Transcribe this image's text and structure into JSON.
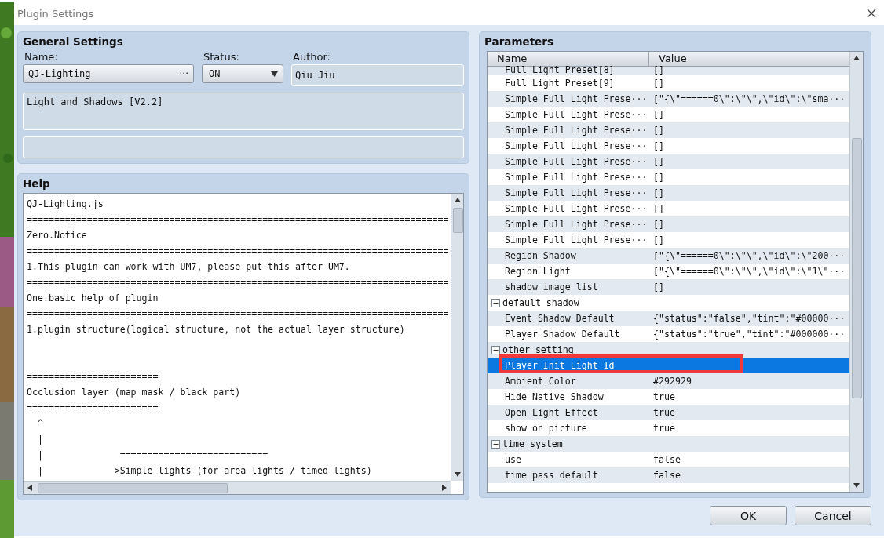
{
  "window": {
    "title": "Plugin Settings"
  },
  "general_settings": {
    "title": "General Settings",
    "name_label": "Name:",
    "name_value": "QJ-Lighting",
    "name_button": "···",
    "status_label": "Status:",
    "status_value": "ON",
    "author_label": "Author:",
    "author_value": "Qiu Jiu",
    "description": "Light and Shadows [V2.2]"
  },
  "help": {
    "title": "Help",
    "lines": [
      {
        "kind": "text",
        "text": "QJ-Lighting.js"
      },
      {
        "kind": "text",
        "text": "============================================================================="
      },
      {
        "kind": "text",
        "text": "Zero.Notice"
      },
      {
        "kind": "text",
        "text": "============================================================================="
      },
      {
        "kind": "text",
        "text": "1.This plugin can work with UM7, please put this after UM7."
      },
      {
        "kind": "text",
        "text": "============================================================================="
      },
      {
        "kind": "text",
        "text": "One.basic help of plugin"
      },
      {
        "kind": "text",
        "text": "============================================================================="
      },
      {
        "kind": "text",
        "text": "1.plugin structure(logical structure, not the actual layer structure)"
      },
      {
        "kind": "blank"
      },
      {
        "kind": "blank"
      },
      {
        "kind": "text",
        "text": "========================"
      },
      {
        "kind": "text",
        "text": "Occlusion layer (map mask / black part)"
      },
      {
        "kind": "text",
        "text": "========================"
      },
      {
        "kind": "text",
        "text": "  ^"
      },
      {
        "kind": "text",
        "text": "  |"
      },
      {
        "kind": "text",
        "text": "  |              ==========================="
      },
      {
        "kind": "text",
        "text": "  |             >Simple lights (for area lights / timed lights)"
      }
    ]
  },
  "parameters": {
    "title": "Parameters",
    "columns": [
      "Name",
      "Value"
    ],
    "rows": [
      {
        "kind": "param",
        "name": "Full Light Preset[8]",
        "value": "[]",
        "selected": false
      },
      {
        "kind": "param",
        "name": "Full Light Preset[9]",
        "value": "[]",
        "selected": false
      },
      {
        "kind": "param",
        "name": "Simple Full Light Prese···",
        "value": "[\"{\\\"======0\\\":\\\"\\\",\\\"id\\\":\\\"sma···",
        "selected": false
      },
      {
        "kind": "param",
        "name": "Simple Full Light Prese···",
        "value": "[]",
        "selected": false
      },
      {
        "kind": "param",
        "name": "Simple Full Light Prese···",
        "value": "[]",
        "selected": false
      },
      {
        "kind": "param",
        "name": "Simple Full Light Prese···",
        "value": "[]",
        "selected": false
      },
      {
        "kind": "param",
        "name": "Simple Full Light Prese···",
        "value": "[]",
        "selected": false
      },
      {
        "kind": "param",
        "name": "Simple Full Light Prese···",
        "value": "[]",
        "selected": false
      },
      {
        "kind": "param",
        "name": "Simple Full Light Prese···",
        "value": "[]",
        "selected": false
      },
      {
        "kind": "param",
        "name": "Simple Full Light Prese···",
        "value": "[]",
        "selected": false
      },
      {
        "kind": "param",
        "name": "Simple Full Light Prese···",
        "value": "[]",
        "selected": false
      },
      {
        "kind": "param",
        "name": "Simple Full Light Prese···",
        "value": "[]",
        "selected": false
      },
      {
        "kind": "param",
        "name": "Region Shadow",
        "value": "[\"{\\\"======0\\\":\\\"\\\",\\\"id\\\":\\\"200···",
        "selected": false
      },
      {
        "kind": "param",
        "name": "Region Light",
        "value": "[\"{\\\"======0\\\":\\\"\\\",\\\"id\\\":\\\"1\\\"···",
        "selected": false
      },
      {
        "kind": "param",
        "name": "shadow image list",
        "value": "[]",
        "selected": false
      },
      {
        "kind": "group",
        "name": "default shadow",
        "expanded": true,
        "children": [
          {
            "kind": "param",
            "name": "Event Shadow Default",
            "value": "{\"status\":\"false\",\"tint\":\"#00000···",
            "selected": false
          },
          {
            "kind": "param",
            "name": "Player Shadow Default",
            "value": "{\"status\":\"true\",\"tint\":\"#000000···",
            "selected": false
          }
        ]
      },
      {
        "kind": "group",
        "name": "other setting",
        "expanded": true,
        "children": [
          {
            "kind": "param",
            "name": "Player Init Light Id",
            "selected": true
          },
          {
            "kind": "param",
            "name": "Ambient Color",
            "value": "#292929",
            "selected": false
          },
          {
            "kind": "param",
            "name": "Hide Native Shadow",
            "value": "true",
            "selected": false
          },
          {
            "kind": "param",
            "name": "Open Light Effect",
            "value": "true",
            "selected": false
          },
          {
            "kind": "param",
            "name": "show on picture",
            "value": "true",
            "selected": false
          }
        ]
      },
      {
        "kind": "group",
        "name": "time system",
        "expanded": true,
        "children": [
          {
            "kind": "param",
            "name": "use",
            "value": "false",
            "selected": false
          },
          {
            "kind": "param",
            "name": "time pass default",
            "value": "false",
            "selected": false
          }
        ]
      }
    ]
  },
  "buttons": [
    "OK",
    "Cancel"
  ]
}
